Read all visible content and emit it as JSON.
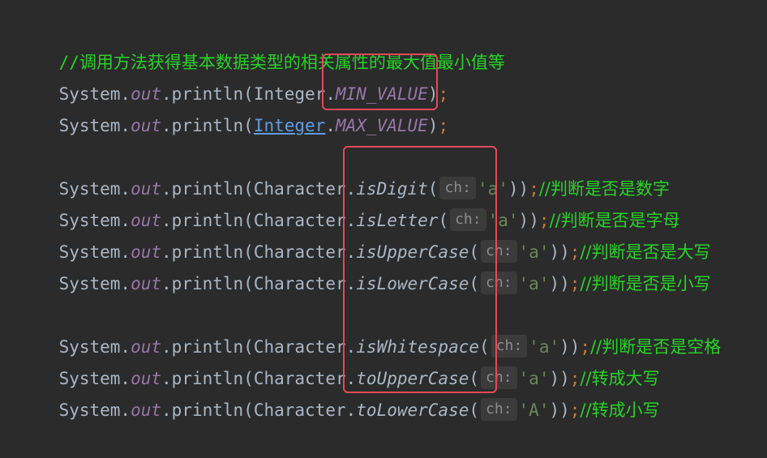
{
  "comment_line": {
    "prefix": "//",
    "text": "调用方法获得基本数据类型的相关属性的最大值最小值等"
  },
  "lines": [
    {
      "obj": "System.",
      "out": "out",
      "println": ".println(",
      "cls": "Integer",
      "dot": ".",
      "member": "MIN_VALUE",
      "close": ")",
      "semi": ";"
    },
    {
      "obj": "System.",
      "out": "out",
      "println": ".println(",
      "cls": "Integer",
      "dot": ".",
      "member": "MAX_VALUE",
      "close": ")",
      "semi": ";"
    }
  ],
  "char_lines": [
    {
      "method": "isDigit",
      "hint": "ch:",
      "arg": "'a'",
      "comment": "//判断是否是数字"
    },
    {
      "method": "isLetter",
      "hint": "ch:",
      "arg": "'a'",
      "comment": "//判断是否是字母"
    },
    {
      "method": "isUpperCase",
      "hint": "ch:",
      "arg": "'a'",
      "comment": "//判断是否是大写"
    },
    {
      "method": "isLowerCase",
      "hint": "ch:",
      "arg": "'a'",
      "comment": "//判断是否是小写"
    },
    {
      "method": "isWhitespace",
      "hint": "ch:",
      "arg": "'a'",
      "comment": "//判断是否是空格"
    },
    {
      "method": "toUpperCase",
      "hint": "ch:",
      "arg": "'a'",
      "comment": "//转成大写"
    },
    {
      "method": "toLowerCase",
      "hint": "ch:",
      "arg": "'A'",
      "comment": "//转成小写"
    }
  ],
  "common": {
    "system": "System.",
    "out": "out",
    "println": ".println(",
    "character": "Character",
    "dot": ".",
    "open": "(",
    "close": "))",
    "semi": ";"
  },
  "colors": {
    "background": "#2b2b2b",
    "comment": "#27d327",
    "static_field": "#9876aa",
    "string": "#6a8759",
    "keyword_semicolon": "#cc7832",
    "highlight_box": "#e24a57",
    "link": "#5c9ee6"
  }
}
